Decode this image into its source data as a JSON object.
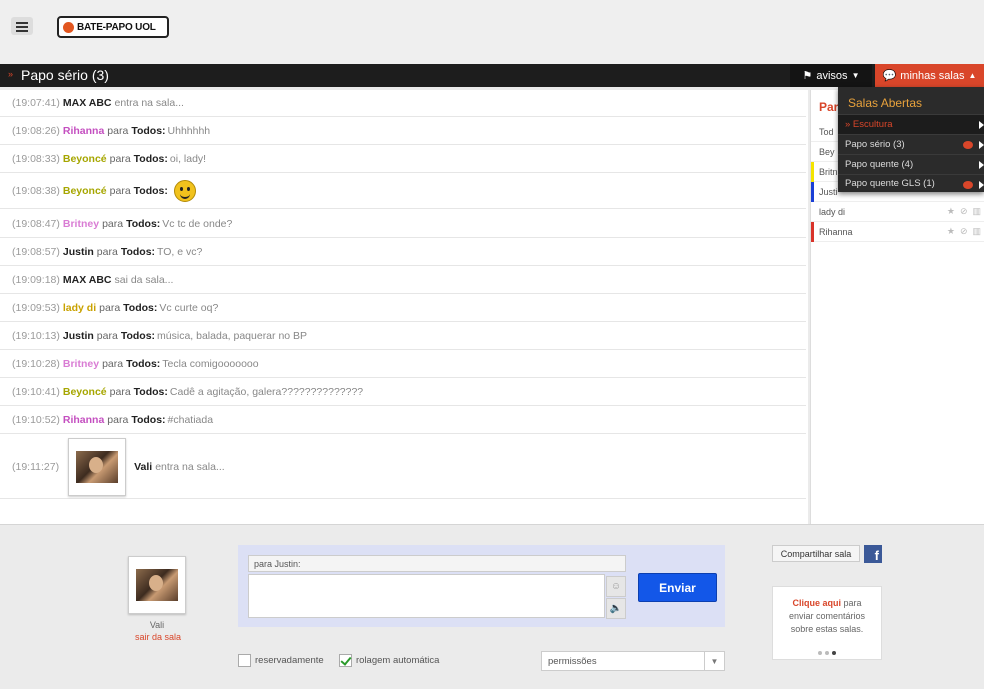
{
  "header": {
    "logo_text": "BATE-PAPO UOL"
  },
  "room": {
    "title": "Papo sério (3)",
    "avisos_label": "avisos",
    "minhas_salas_label": "minhas salas"
  },
  "chat": {
    "messages": [
      {
        "time": "(19:07:41)",
        "nick": "MAX ABC",
        "nick_color": "#222222",
        "mid": "",
        "to": "",
        "text": "entra na sala..."
      },
      {
        "time": "(19:08:26)",
        "nick": "Rihanna",
        "nick_color": "#c44fc0",
        "mid": "para",
        "to": "Todos:",
        "text": "Uhhhhhh"
      },
      {
        "time": "(19:08:33)",
        "nick": "Beyoncé",
        "nick_color": "#a6a600",
        "mid": "para",
        "to": "Todos:",
        "text": "oi, lady!"
      },
      {
        "time": "(19:08:38)",
        "nick": "Beyoncé",
        "nick_color": "#a6a600",
        "mid": "para",
        "to": "Todos:",
        "text": ""
      },
      {
        "time": "(19:08:47)",
        "nick": "Britney",
        "nick_color": "#d97cd4",
        "mid": "para",
        "to": "Todos:",
        "text": "Vc tc de onde?"
      },
      {
        "time": "(19:08:57)",
        "nick": "Justin",
        "nick_color": "#222222",
        "mid": "para",
        "to": "Todos:",
        "text": "TO, e vc?"
      },
      {
        "time": "(19:09:18)",
        "nick": "MAX ABC",
        "nick_color": "#222222",
        "mid": "",
        "to": "",
        "text": "sai da sala..."
      },
      {
        "time": "(19:09:53)",
        "nick": "lady di",
        "nick_color": "#c9a200",
        "mid": "para",
        "to": "Todos:",
        "text": "Vc curte oq?"
      },
      {
        "time": "(19:10:13)",
        "nick": "Justin",
        "nick_color": "#222222",
        "mid": "para",
        "to": "Todos:",
        "text": "música, balada, paquerar no BP"
      },
      {
        "time": "(19:10:28)",
        "nick": "Britney",
        "nick_color": "#d97cd4",
        "mid": "para",
        "to": "Todos:",
        "text": "Tecla comigooooooo"
      },
      {
        "time": "(19:10:41)",
        "nick": "Beyoncé",
        "nick_color": "#a6a600",
        "mid": "para",
        "to": "Todos:",
        "text": "Cadê a agitação, galera??????????????"
      },
      {
        "time": "(19:10:52)",
        "nick": "Rihanna",
        "nick_color": "#c44fc0",
        "mid": "para",
        "to": "Todos:",
        "text": "#chatiada"
      },
      {
        "time": "(19:11:27)",
        "nick": "Vali",
        "nick_color": "#222222",
        "mid": "",
        "to": "",
        "text": "entra na sala..."
      }
    ]
  },
  "participants": {
    "title": "Par",
    "users": [
      {
        "name": "Tod",
        "bar_color": ""
      },
      {
        "name": "Bey",
        "bar_color": ""
      },
      {
        "name": "Britn",
        "bar_color": "#f4e400"
      },
      {
        "name": "Justi",
        "bar_color": "#1a3fd6"
      },
      {
        "name": "lady di",
        "bar_color": ""
      },
      {
        "name": "Rihanna",
        "bar_color": "#d9332a"
      }
    ]
  },
  "dropdown": {
    "title": "Salas Abertas",
    "items": [
      {
        "label": "» Escultura",
        "active": true,
        "bubble": false
      },
      {
        "label": "Papo sério (3)",
        "active": false,
        "bubble": true
      },
      {
        "label": "Papo quente (4)",
        "active": false,
        "bubble": false
      },
      {
        "label": "Papo quente GLS (1)",
        "active": false,
        "bubble": true
      }
    ]
  },
  "me": {
    "name": "Vali",
    "leave_label": "sair da sala"
  },
  "compose": {
    "to_text": "para Justin:",
    "send_label": "Enviar"
  },
  "options": {
    "reservado_label": "reservadamente",
    "reservado_checked": false,
    "rolagem_label": "rolagem automática",
    "rolagem_checked": true,
    "permissoes_value": "permissões"
  },
  "share": {
    "share_label": "Compartilhar sala",
    "fb_letter": "f"
  },
  "promo": {
    "link_text": "Clique aqui",
    "text_after": "para enviar comentários sobre estas salas."
  },
  "colors": {
    "accent": "#d9462a",
    "send_button": "#1357e8",
    "dark_bar": "#1d1d1d"
  }
}
